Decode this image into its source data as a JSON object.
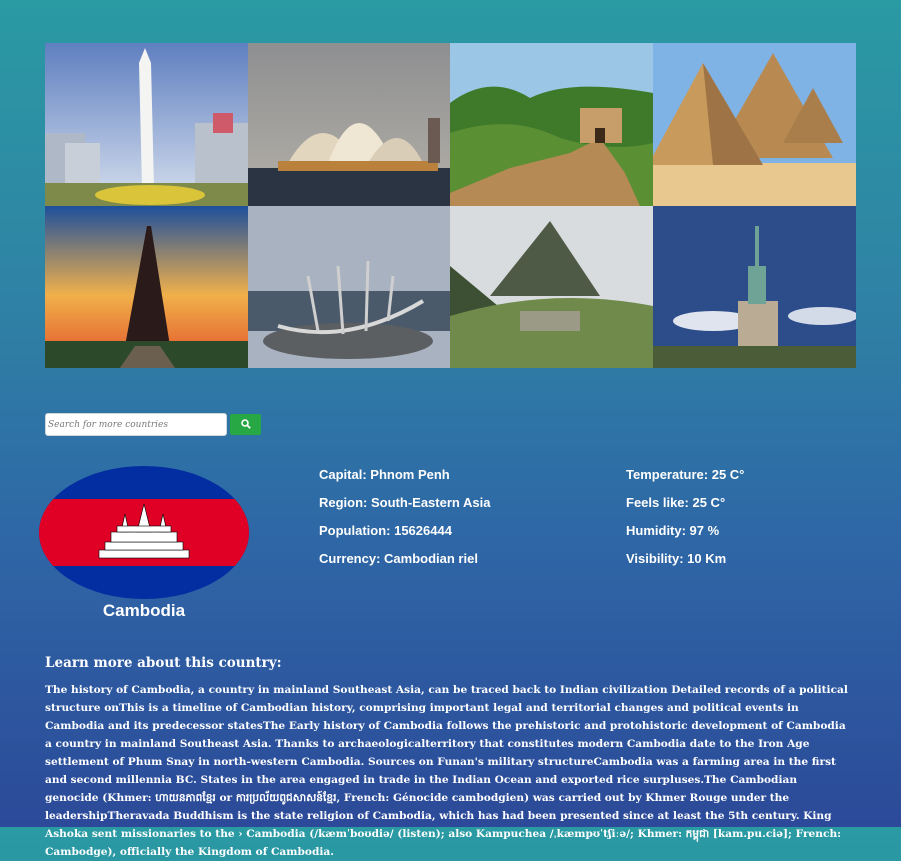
{
  "gallery": [
    {
      "name": "obelisk-photo"
    },
    {
      "name": "opera-house-photo"
    },
    {
      "name": "great-wall-photo"
    },
    {
      "name": "pyramids-photo"
    },
    {
      "name": "eiffel-tower-photo"
    },
    {
      "name": "sun-voyager-photo"
    },
    {
      "name": "machu-picchu-photo"
    },
    {
      "name": "statue-of-liberty-photo"
    }
  ],
  "search": {
    "placeholder": "Search for more countries",
    "button_icon": "search-icon",
    "button_color": "#28a745"
  },
  "country": {
    "name": "Cambodia",
    "flag_colors": {
      "blue": "#032ea1",
      "red": "#e00025"
    }
  },
  "details": {
    "capital": "Capital: Phnom Penh",
    "region": "Region: South-Eastern Asia",
    "population": "Population: 15626444",
    "currency": "Currency: Cambodian riel"
  },
  "weather": {
    "temperature": "Temperature: 25 C°",
    "feels_like": "Feels like: 25 C°",
    "humidity": "Humidity: 97 %",
    "visibility": "Visibility: 10 Km"
  },
  "learn_more": {
    "heading": "Learn more about this country:",
    "text": "The history of Cambodia, a country in mainland Southeast Asia, can be traced back to Indian civilization Detailed records of a political structure onThis is a timeline of Cambodian history, comprising important legal and territorial changes and political events in Cambodia and its predecessor statesThe Early history of Cambodia follows the prehistoric and protohistoric development of Cambodia a country in mainland Southeast Asia. Thanks to archaeologicalterritory that constitutes modern Cambodia date to the Iron Age settlement of Phum Snay in north-western Cambodia. Sources on Funan's military structureCambodia was a farming area in the first and second millennia BC. States in the area engaged in trade in the Indian Ocean and exported rice surpluses.The Cambodian genocide (Khmer: ហាយនភាពខ្មែរ or ការប្រល័យពូជសាសន៍ខ្មែរ, French: Génocide cambodgien) was carried out by Khmer Rouge under the leadershipTheravada Buddhism is the state religion of Cambodia, which has had been presented since at least the 5th century. King Ashoka sent missionaries to the › Cambodia (/kæmˈboʊdiə/ (listen); also Kampuchea /ˌkæmpʊˈtʃiːə/; Khmer: កម្ពុជា [kam.pu.ciə]; French: Cambodge), officially the Kingdom of Cambodia."
  }
}
